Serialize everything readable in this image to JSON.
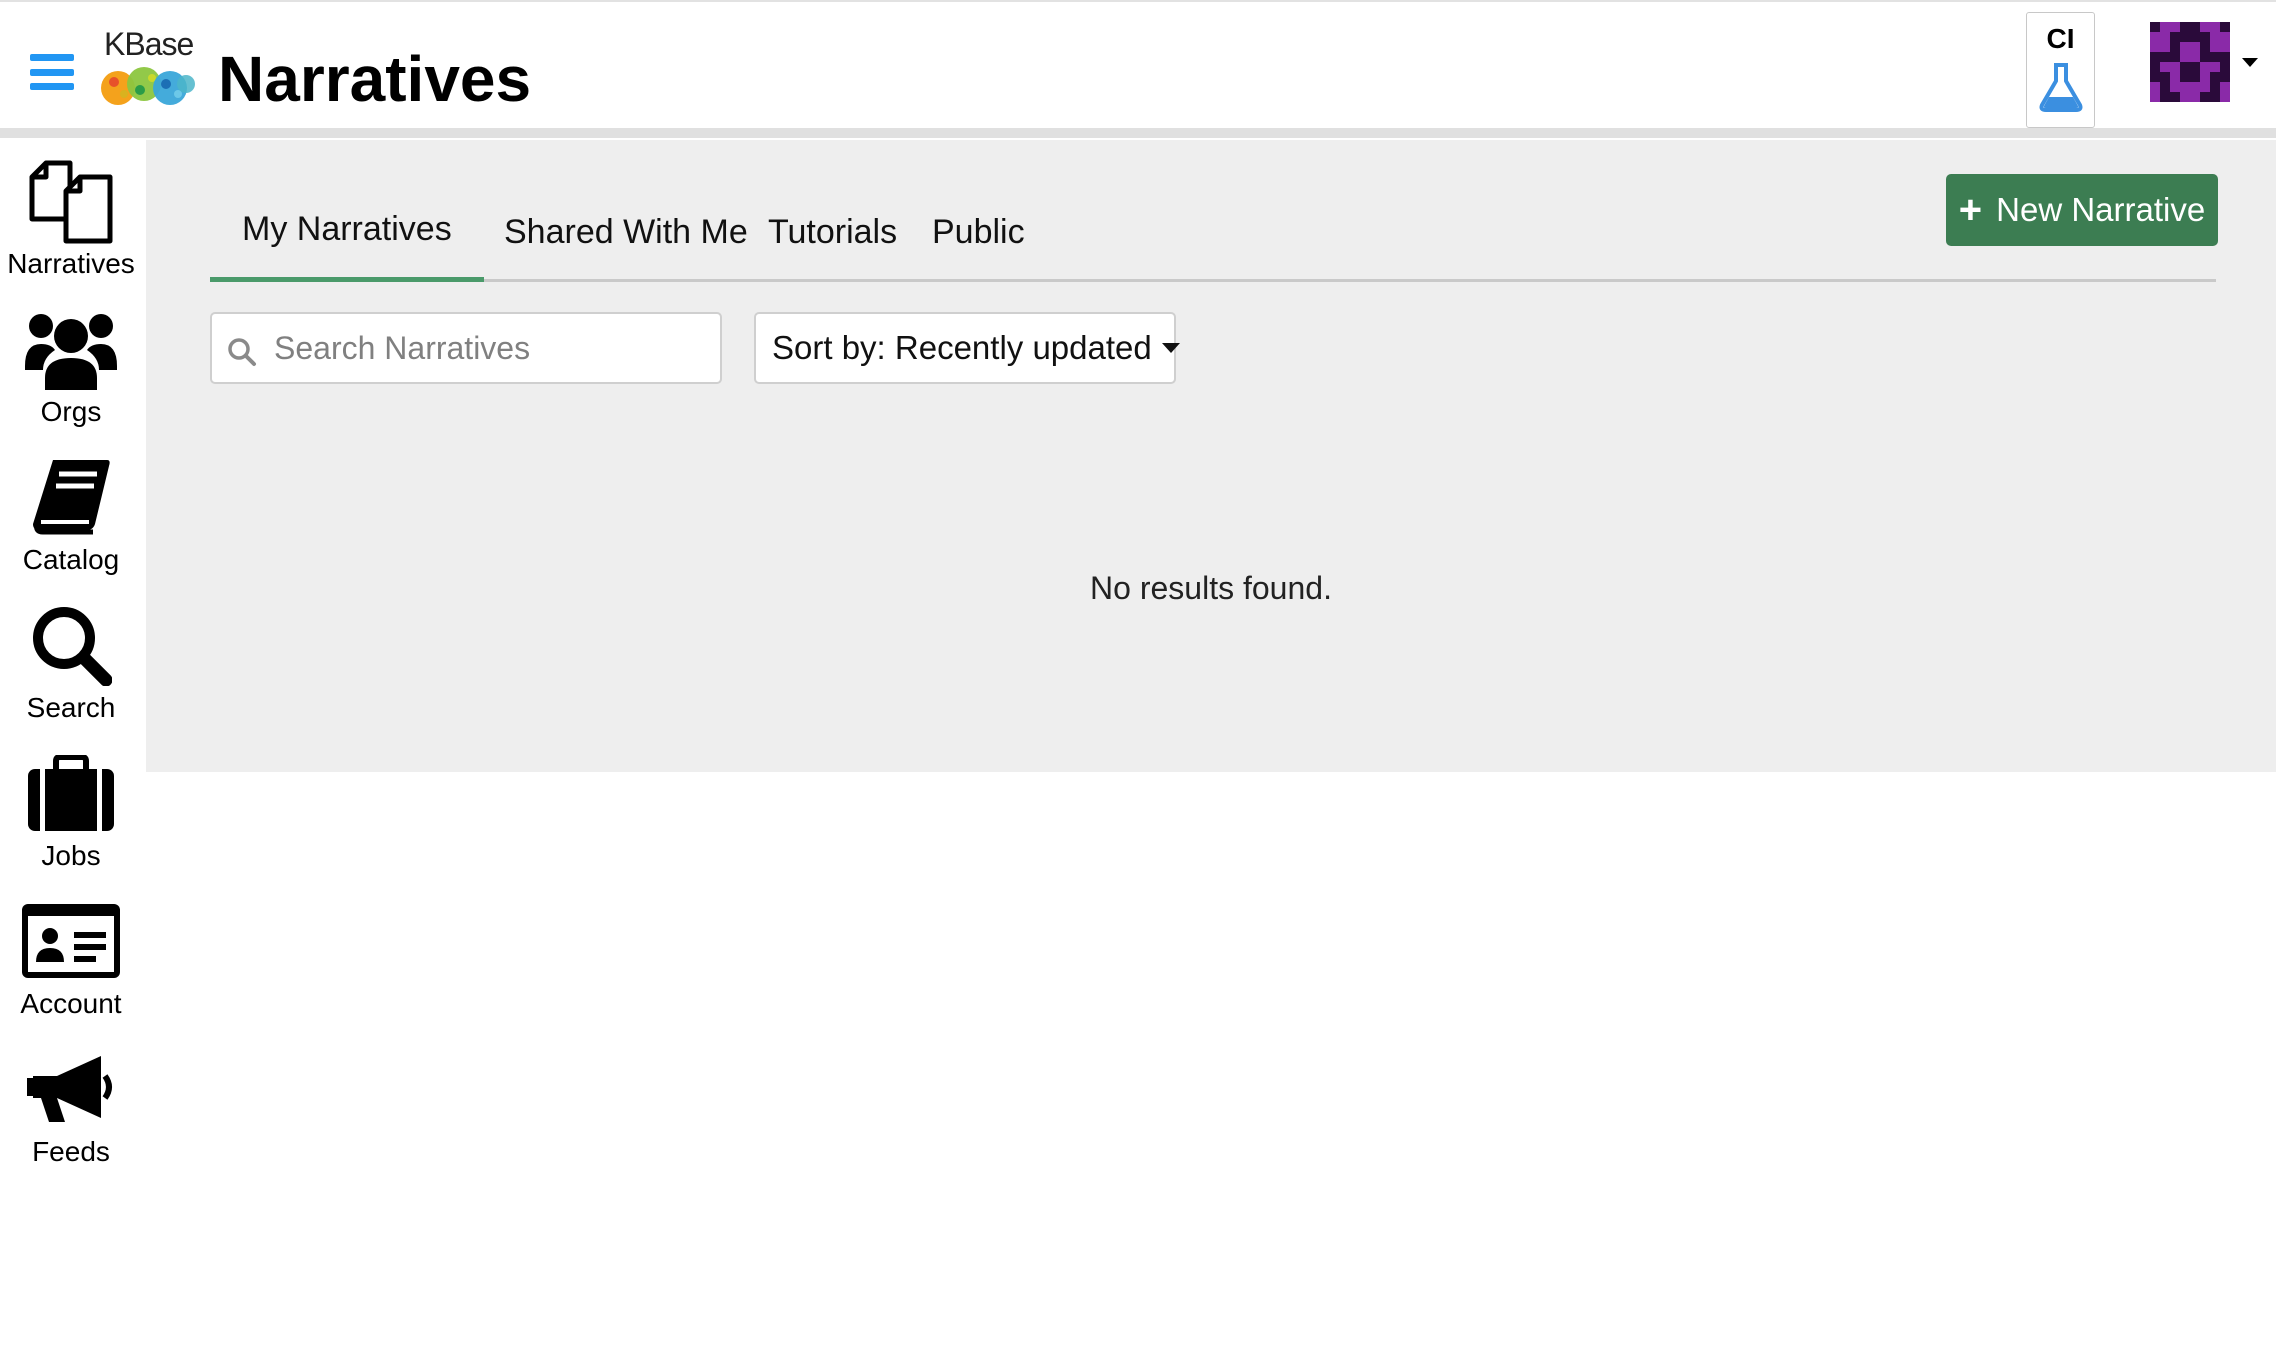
{
  "header": {
    "logo_text": "KBase",
    "page_title": "Narratives",
    "env_badge": "CI",
    "menu_icon": "hamburger-icon",
    "env_icon": "flask-icon",
    "avatar_colors": [
      "#2a0a3a",
      "#8a2aa8"
    ]
  },
  "sidebar": {
    "items": [
      {
        "label": "Narratives",
        "icon": "documents-icon"
      },
      {
        "label": "Orgs",
        "icon": "users-icon"
      },
      {
        "label": "Catalog",
        "icon": "book-icon"
      },
      {
        "label": "Search",
        "icon": "search-icon"
      },
      {
        "label": "Jobs",
        "icon": "suitcase-icon"
      },
      {
        "label": "Account",
        "icon": "id-card-icon"
      },
      {
        "label": "Feeds",
        "icon": "bullhorn-icon"
      }
    ]
  },
  "main": {
    "tabs": [
      {
        "label": "My Narratives",
        "active": true
      },
      {
        "label": "Shared With Me",
        "active": false
      },
      {
        "label": "Tutorials",
        "active": false
      },
      {
        "label": "Public",
        "active": false
      }
    ],
    "new_button_label": "New Narrative",
    "search_placeholder": "Search Narratives",
    "search_value": "",
    "sort_label": "Sort by: Recently updated",
    "empty_message": "No results found."
  },
  "colors": {
    "accent_blue": "#2196f3",
    "brand_green": "#3c7d52",
    "tab_active_underline": "#4a9a6a",
    "main_background": "#eeeeee"
  }
}
